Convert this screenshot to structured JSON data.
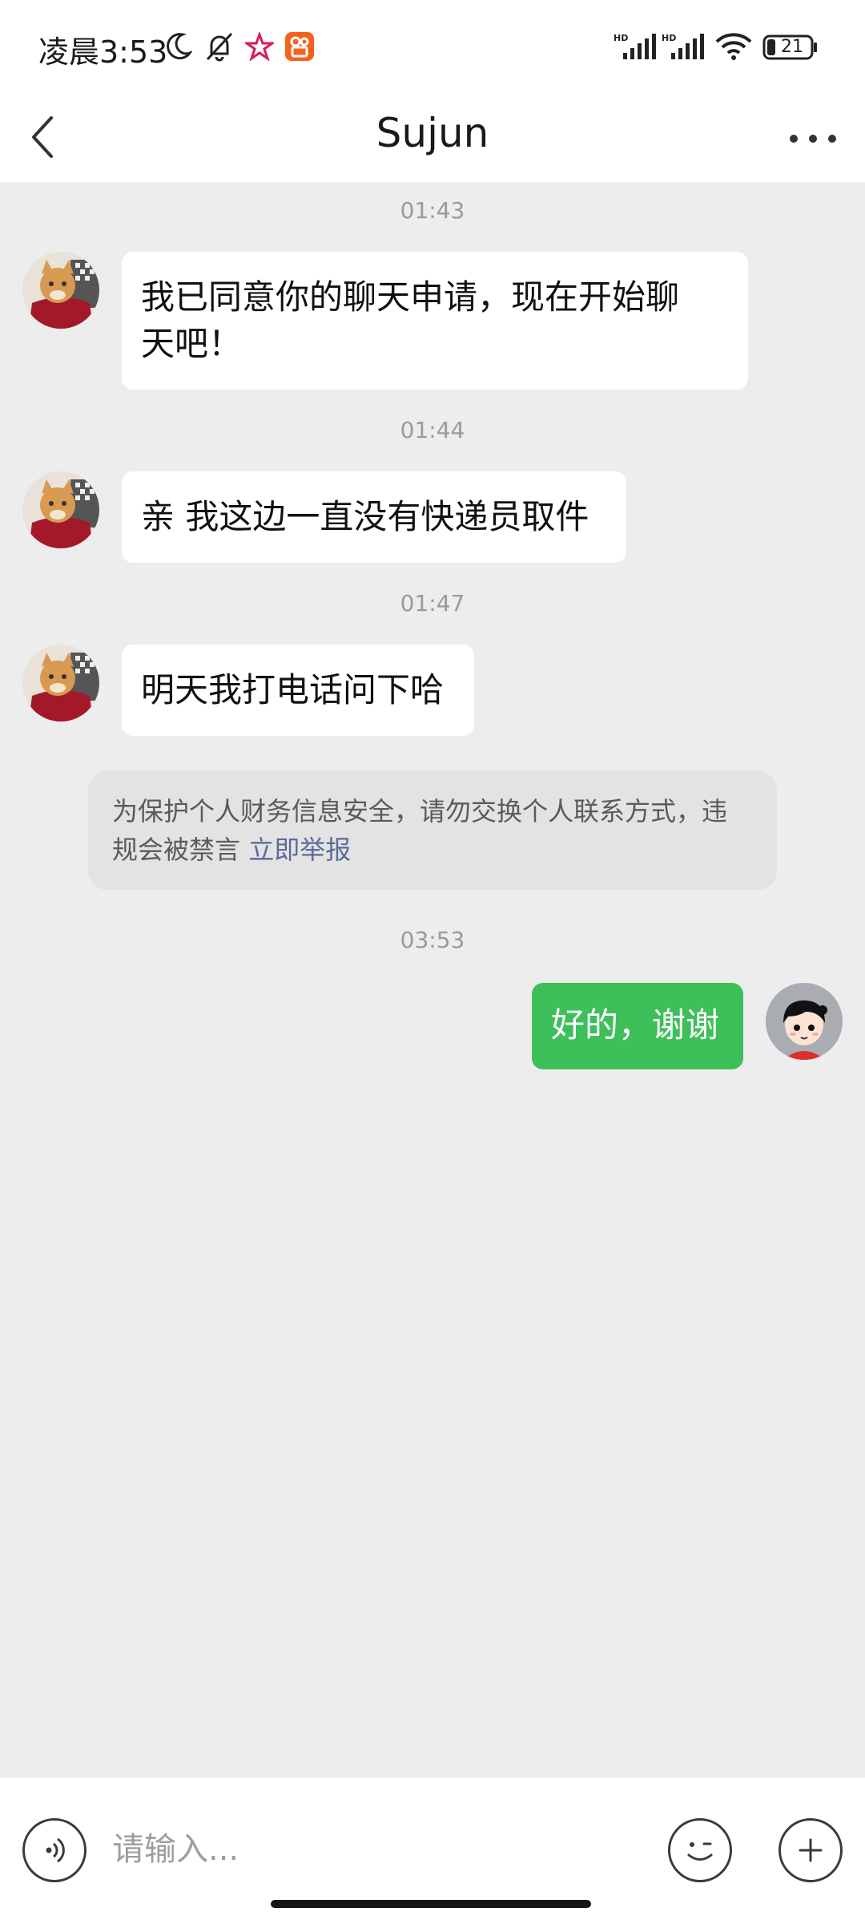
{
  "status_bar": {
    "time": "凌晨3:53",
    "battery": "21",
    "network_label": "HD",
    "icons": [
      "moon-icon",
      "bell-off-icon",
      "star-app-icon",
      "kuaishou-app-icon",
      "hd-signal-icon",
      "hd-signal-icon",
      "wifi-icon",
      "battery-icon"
    ]
  },
  "header": {
    "title": "Sujun",
    "back_icon": "chevron-left-icon",
    "more_icon": "more-horizontal-icon"
  },
  "messages": [
    {
      "time": "01:43",
      "sender": "other",
      "text_lines": [
        "我已同意你的聊天申请，现在开始聊",
        "天吧！"
      ]
    },
    {
      "time": "01:44",
      "sender": "other",
      "text": "亲 我这边一直没有快递员取件"
    },
    {
      "time": "01:47",
      "sender": "other",
      "text": "明天我打电话问下哈"
    },
    {
      "time": "03:53",
      "sender": "self",
      "text": "好的，谢谢"
    }
  ],
  "notice": {
    "text_line1": "为保护个人财务信息安全，请勿交换个人联系方式，违",
    "text_line2": "规会被禁言",
    "link": "立即举报"
  },
  "input_bar": {
    "placeholder": "请输入...",
    "voice_icon": "voice-icon",
    "emoji_icon": "emoji-icon",
    "plus_icon": "plus-icon"
  },
  "colors": {
    "background": "#ededed",
    "self_bubble": "#3dbf5a",
    "other_bubble": "#ffffff",
    "link": "#5b6b9a"
  }
}
